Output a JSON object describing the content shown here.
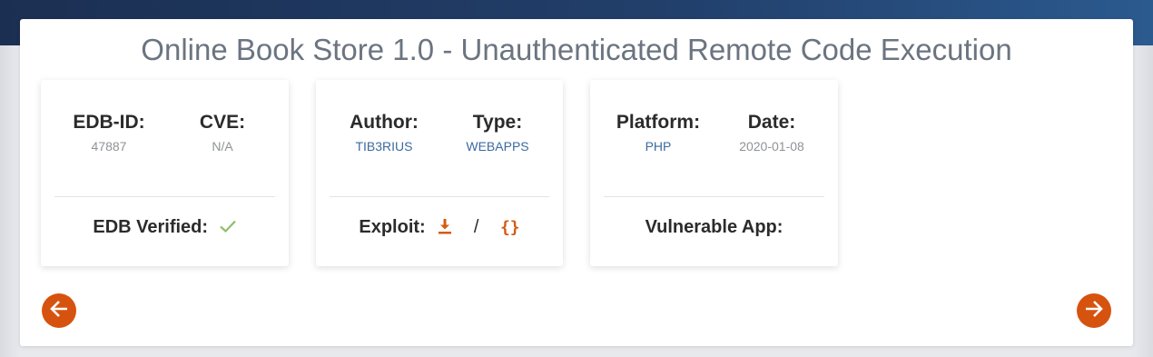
{
  "page": {
    "title": "Online Book Store 1.0 - Unauthenticated Remote Code Execution"
  },
  "cards": {
    "edb": {
      "edb_id_label": "EDB-ID:",
      "edb_id_value": "47887",
      "cve_label": "CVE:",
      "cve_value": "N/A",
      "verified_label": "EDB Verified:",
      "verified_icon": "check-icon",
      "verified_color": "#8fbf6a"
    },
    "author": {
      "author_label": "Author:",
      "author_value": "TIB3RIUS",
      "type_label": "Type:",
      "type_value": "WEBAPPS",
      "exploit_label": "Exploit:",
      "download_icon": "download-icon",
      "separator": "/",
      "raw_icon_text": "{}"
    },
    "platform": {
      "platform_label": "Platform:",
      "platform_value": "PHP",
      "date_label": "Date:",
      "date_value": "2020-01-08",
      "vulnerable_label": "Vulnerable App:"
    }
  },
  "navigation": {
    "prev_icon": "arrow-left-icon",
    "next_icon": "arrow-right-icon"
  },
  "colors": {
    "accent": "#d6530f",
    "link": "#3c6b9e",
    "header_bar": "#22406c"
  }
}
